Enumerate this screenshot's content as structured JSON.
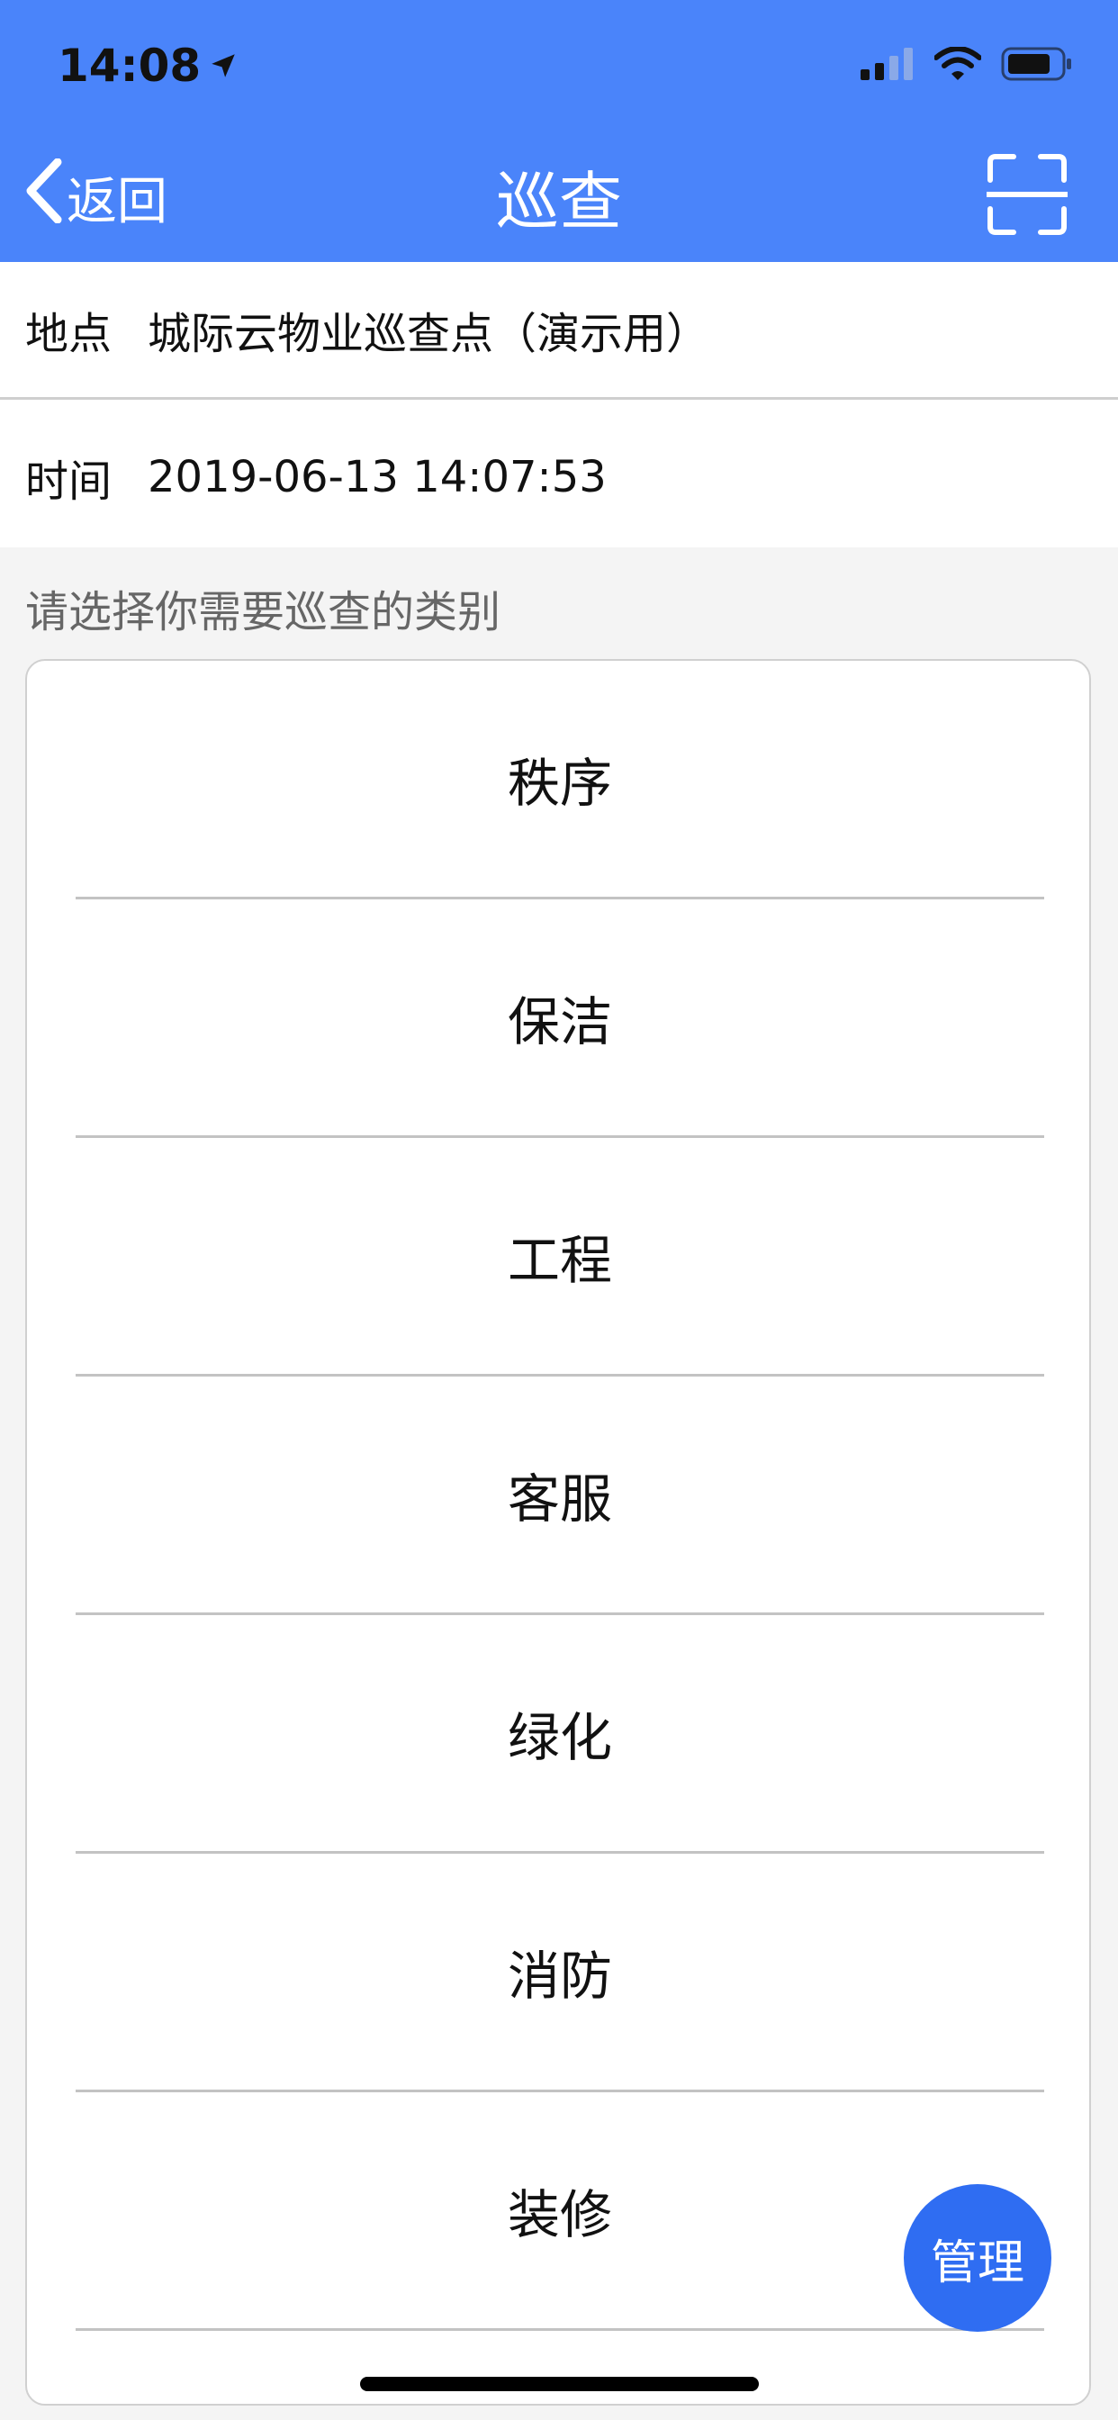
{
  "status_bar": {
    "time": "14:08",
    "icons": [
      "location-arrow-icon",
      "signal-icon",
      "wifi-icon",
      "battery-icon"
    ]
  },
  "nav": {
    "back_label": "返回",
    "title": "巡查",
    "right_icon": "scan-icon"
  },
  "info": {
    "location_label": "地点",
    "location_value": "城际云物业巡查点（演示用）",
    "time_label": "时间",
    "time_value": "2019-06-13 14:07:53"
  },
  "prompt": "请选择你需要巡查的类别",
  "categories": [
    "秩序",
    "保洁",
    "工程",
    "客服",
    "绿化",
    "消防",
    "装修"
  ],
  "fab_label": "管理",
  "colors": {
    "header_bg": "#4a84fa",
    "fab_bg": "#2f6df2",
    "page_bg": "#f4f4f4"
  }
}
